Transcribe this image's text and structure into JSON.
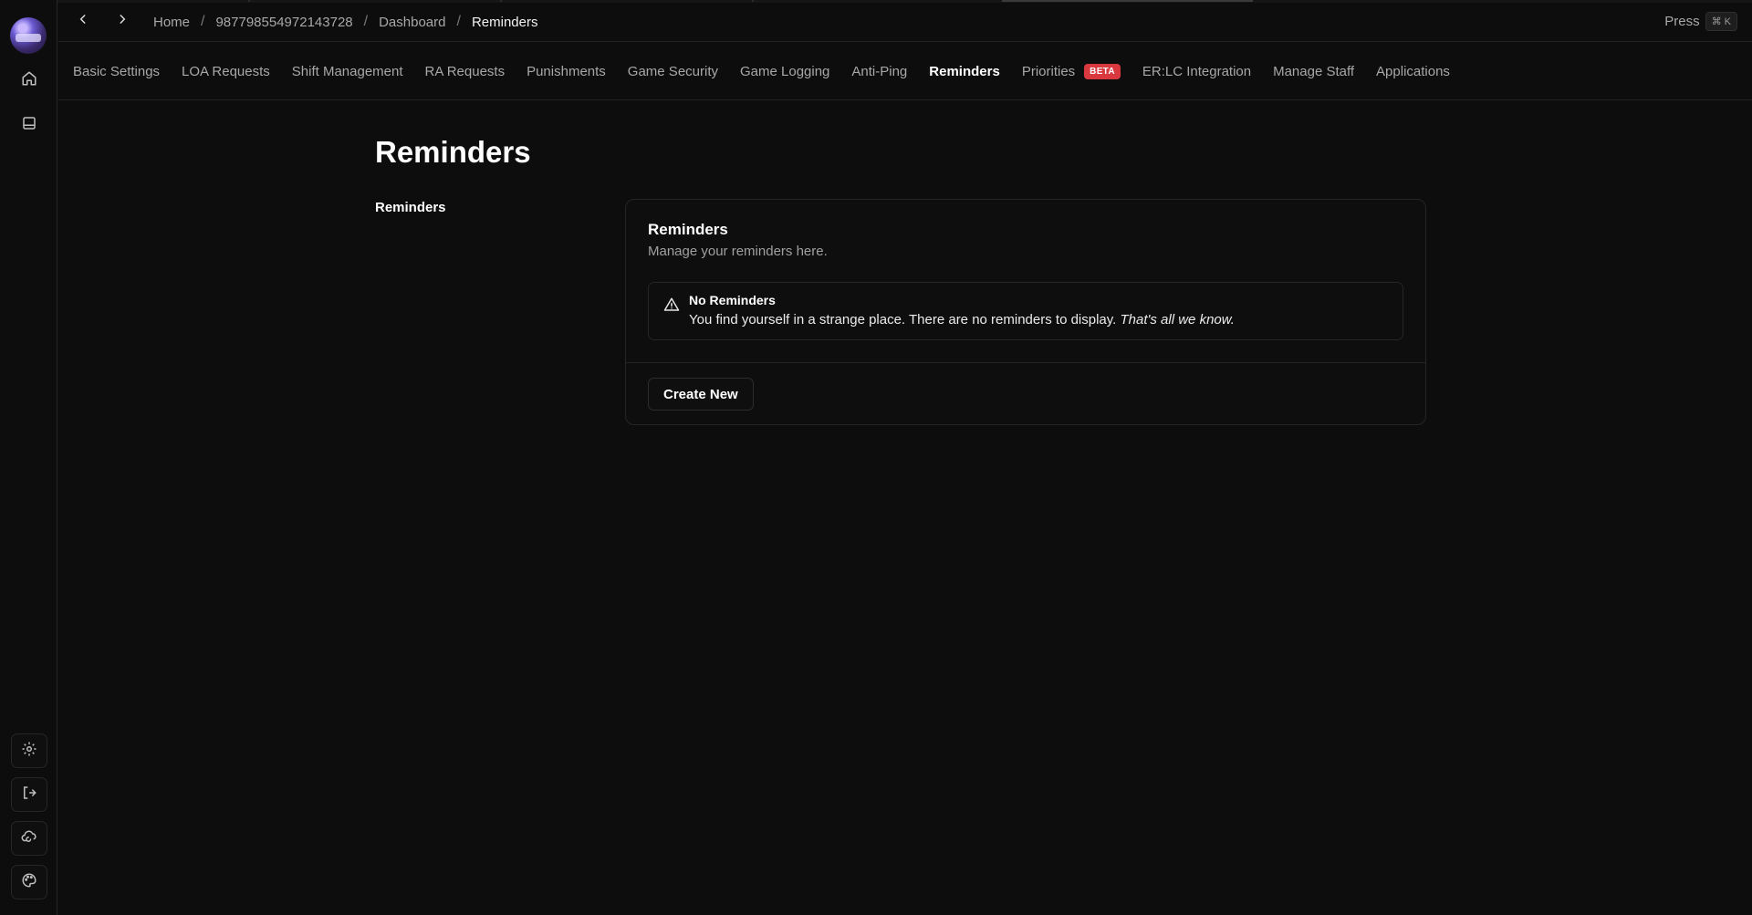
{
  "breadcrumb": [
    {
      "label": "Home"
    },
    {
      "label": "987798554972143728"
    },
    {
      "label": "Dashboard"
    },
    {
      "label": "Reminders"
    }
  ],
  "topbar": {
    "press_label": "Press",
    "shortcut": "⌘ K"
  },
  "tabs": [
    {
      "label": "Basic Settings"
    },
    {
      "label": "LOA Requests"
    },
    {
      "label": "Shift Management"
    },
    {
      "label": "RA Requests"
    },
    {
      "label": "Punishments"
    },
    {
      "label": "Game Security"
    },
    {
      "label": "Game Logging"
    },
    {
      "label": "Anti-Ping"
    },
    {
      "label": "Reminders",
      "active": true
    },
    {
      "label": "Priorities",
      "badge": "BETA"
    },
    {
      "label": "ER:LC Integration"
    },
    {
      "label": "Manage Staff"
    },
    {
      "label": "Applications"
    }
  ],
  "page": {
    "title": "Reminders",
    "section_label": "Reminders"
  },
  "card": {
    "title": "Reminders",
    "description": "Manage your reminders here.",
    "alert": {
      "title": "No Reminders",
      "text": "You find yourself in a strange place. There are no reminders to display.",
      "emphasis": "That's all we know."
    },
    "create_button": "Create New"
  },
  "sidebar": {
    "top_icons": [
      "home-icon",
      "panel-icon"
    ],
    "bottom_icons": [
      "settings-icon",
      "logout-icon",
      "cloud-refresh-icon",
      "palette-icon"
    ]
  },
  "colors": {
    "background": "#0d0d0d",
    "badge": "#d9383f",
    "border": "#262626"
  }
}
